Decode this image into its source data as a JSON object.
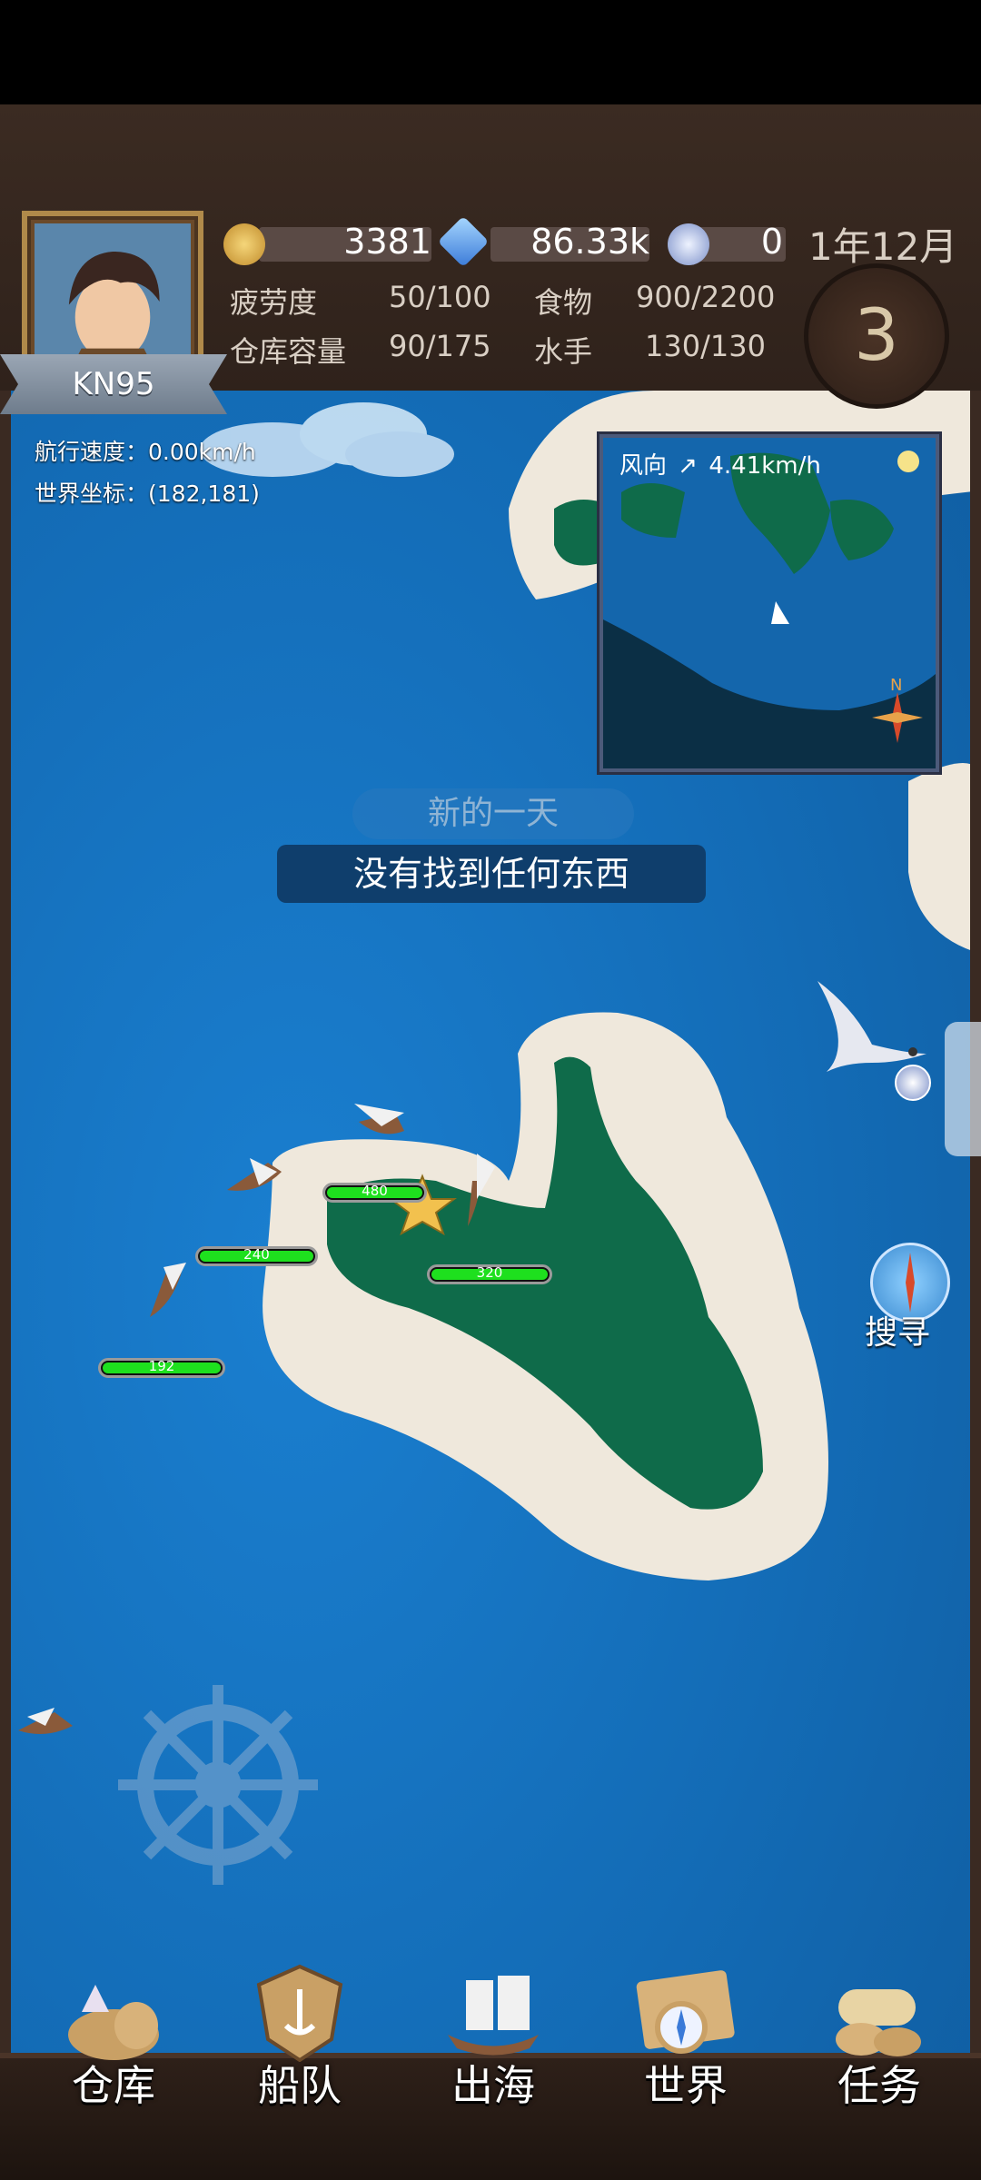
{
  "player": {
    "name": "KN95"
  },
  "resources": {
    "coins": "3381",
    "gems": "86.33k",
    "tokens": "0"
  },
  "date": "1年12月",
  "day": "3",
  "stats": {
    "fatigue_label": "疲劳度",
    "fatigue_value": "50/100",
    "food_label": "食物",
    "food_value": "900/2200",
    "storage_label": "仓库容量",
    "storage_value": "90/175",
    "sailors_label": "水手",
    "sailors_value": "130/130"
  },
  "nav_info": {
    "speed": "航行速度：0.00km/h",
    "coords": "世界坐标：(182,181)"
  },
  "minimap": {
    "wind_label": "风向",
    "wind_speed": "4.41km/h",
    "compass_n": "N"
  },
  "messages": {
    "ghost": "新的一天",
    "main": "没有找到任何东西"
  },
  "hp_bars": {
    "ship1": "480",
    "ship2": "240",
    "ship3": "320",
    "ship4": "192"
  },
  "search_button": "搜寻",
  "bottom_nav": [
    {
      "label": "仓库",
      "icon": "warehouse-icon"
    },
    {
      "label": "船队",
      "icon": "fleet-icon"
    },
    {
      "label": "出海",
      "icon": "set-sail-icon"
    },
    {
      "label": "世界",
      "icon": "world-icon"
    },
    {
      "label": "任务",
      "icon": "quest-icon"
    }
  ],
  "colors": {
    "sea": "#136bb5",
    "island": "#0f6b4a",
    "sand": "#efe8dc",
    "wood": "#3b2b22",
    "hp": "#1ee01e"
  }
}
